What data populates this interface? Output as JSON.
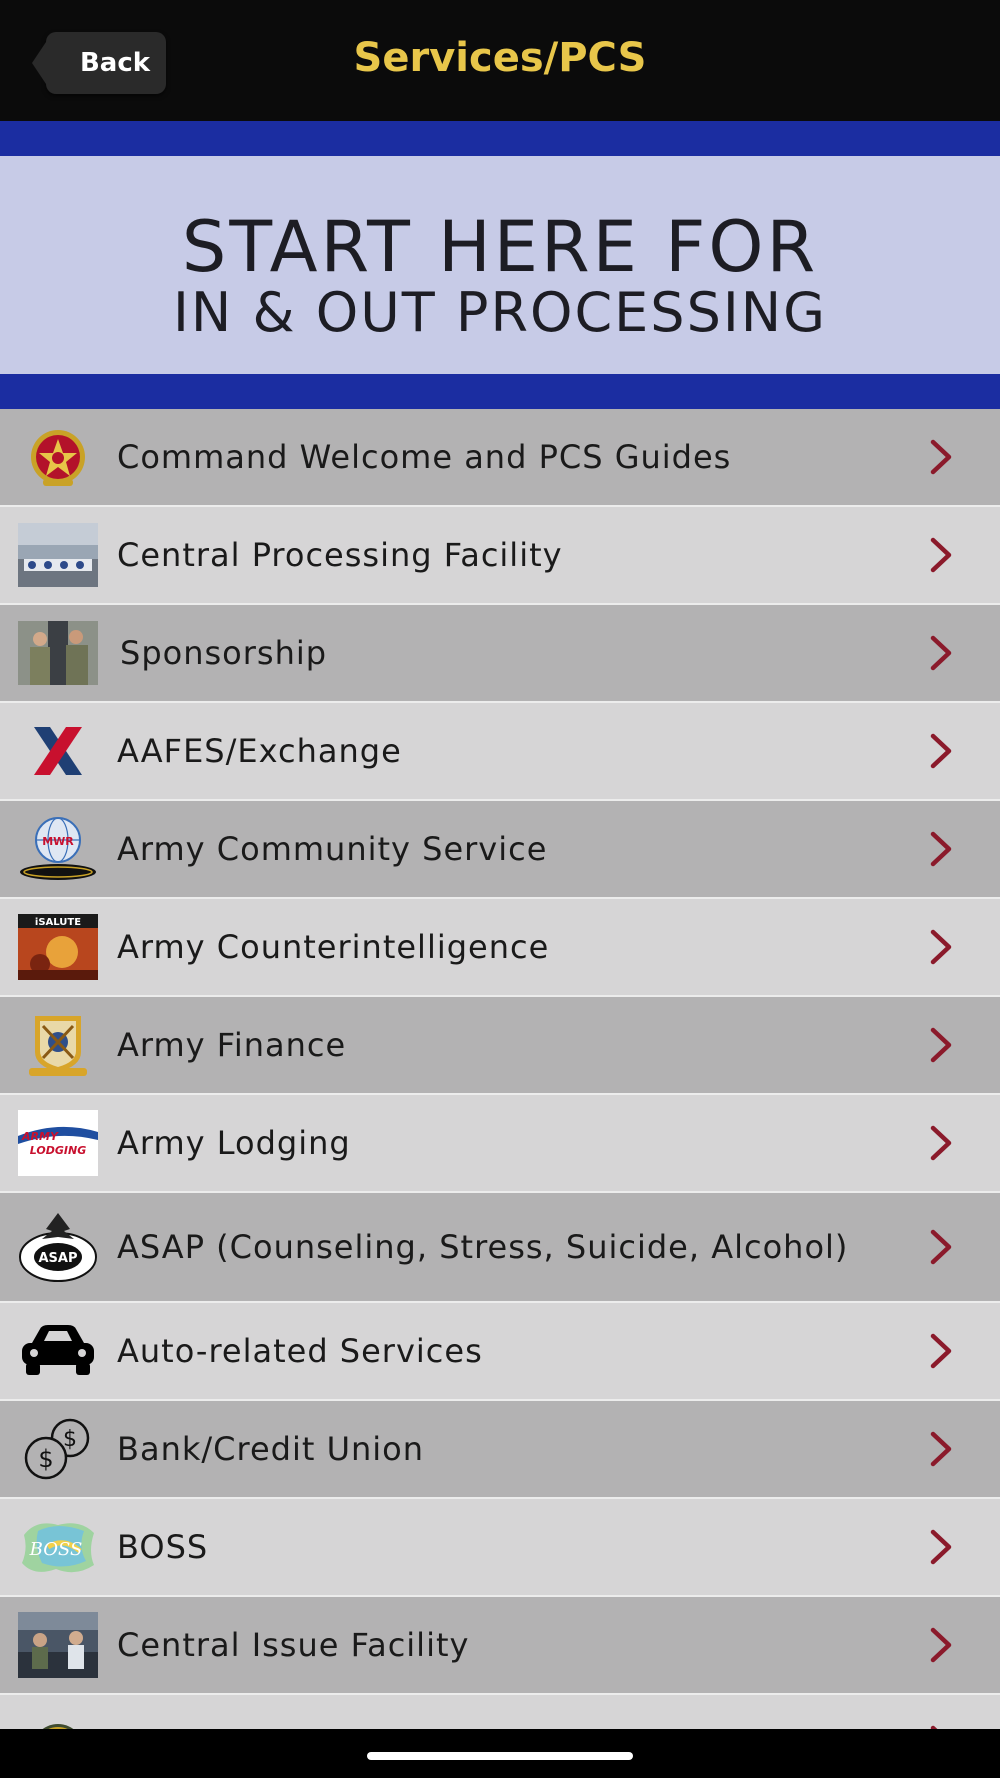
{
  "header": {
    "back_label": "Back",
    "title": "Services/PCS"
  },
  "banner": {
    "line1": "START HERE FOR",
    "line2": "IN & OUT PROCESSING"
  },
  "list": {
    "items": [
      {
        "label": "Command Welcome and PCS Guides",
        "icon": "command-crest-icon"
      },
      {
        "label": "Central Processing Facility",
        "icon": "processing-facility-photo"
      },
      {
        "label": "Sponsorship",
        "icon": "sponsorship-photo"
      },
      {
        "label": "AAFES/Exchange",
        "icon": "exchange-x-logo"
      },
      {
        "label": "Army Community Service",
        "icon": "mwr-acs-logo"
      },
      {
        "label": "Army Counterintelligence",
        "icon": "isalute-poster"
      },
      {
        "label": "Army Finance",
        "icon": "finance-crest-icon"
      },
      {
        "label": "Army Lodging",
        "icon": "army-lodging-logo"
      },
      {
        "label": "ASAP (Counseling, Stress, Suicide, Alcohol)",
        "icon": "asap-eagle-logo"
      },
      {
        "label": "Auto-related Services",
        "icon": "car-icon"
      },
      {
        "label": "Bank/Credit Union",
        "icon": "coins-icon"
      },
      {
        "label": "BOSS",
        "icon": "boss-logo"
      },
      {
        "label": "Central Issue Facility",
        "icon": "issue-facility-photo"
      },
      {
        "label": "",
        "icon": "partial-row-icon"
      }
    ]
  },
  "colors": {
    "header_bg": "#0b0b0b",
    "title": "#e8c64a",
    "banner_blue": "#1b2da1",
    "banner_light": "#c7cbe7",
    "row_dark": "#b3b2b3",
    "row_light": "#d6d5d6",
    "chevron": "#8b1a2b"
  }
}
